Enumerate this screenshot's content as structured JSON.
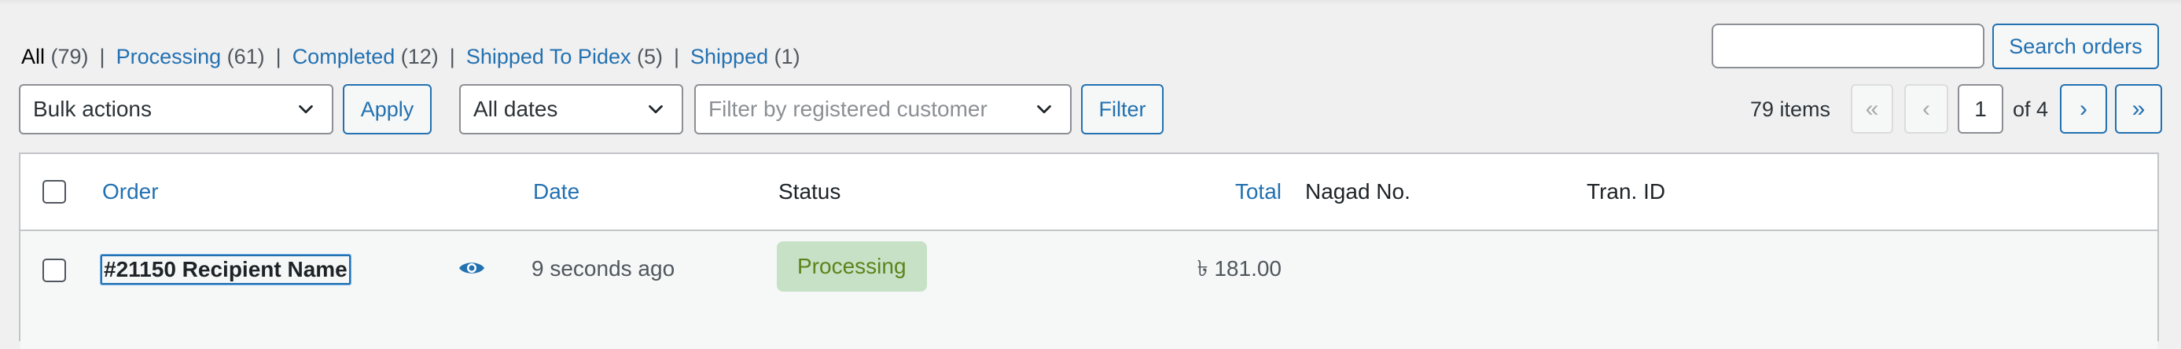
{
  "status_filters": [
    {
      "label": "All",
      "count": "(79)",
      "current": true
    },
    {
      "label": "Processing",
      "count": "(61)"
    },
    {
      "label": "Completed",
      "count": "(12)"
    },
    {
      "label": "Shipped To Pidex",
      "count": "(5)"
    },
    {
      "label": "Shipped",
      "count": "(1)"
    }
  ],
  "separator": "|",
  "search": {
    "value": "",
    "button_label": "Search orders"
  },
  "bulk": {
    "selected": "Bulk actions",
    "apply_label": "Apply"
  },
  "dates": {
    "selected": "All dates"
  },
  "customer": {
    "placeholder": "Filter by registered customer"
  },
  "filter_label": "Filter",
  "pagination": {
    "items": "79 items",
    "first": "«",
    "prev": "‹",
    "current_page": "1",
    "of_text": "of 4",
    "next": "›",
    "last": "»"
  },
  "table": {
    "columns": {
      "order": "Order",
      "date": "Date",
      "status": "Status",
      "total": "Total",
      "nagad": "Nagad No.",
      "tran": "Tran. ID"
    },
    "rows": [
      {
        "order": "#21150 Recipient Name",
        "date": "9 seconds ago",
        "status": "Processing",
        "total": "৳ 181.00",
        "nagad": "",
        "tran": ""
      }
    ]
  },
  "colors": {
    "link": "#2271b1",
    "processing_bg": "#c6e1c6",
    "processing_text": "#5b841b",
    "page_bg": "#f0f0f1"
  },
  "icons": [
    "chevron-down-icon",
    "eye-icon"
  ]
}
